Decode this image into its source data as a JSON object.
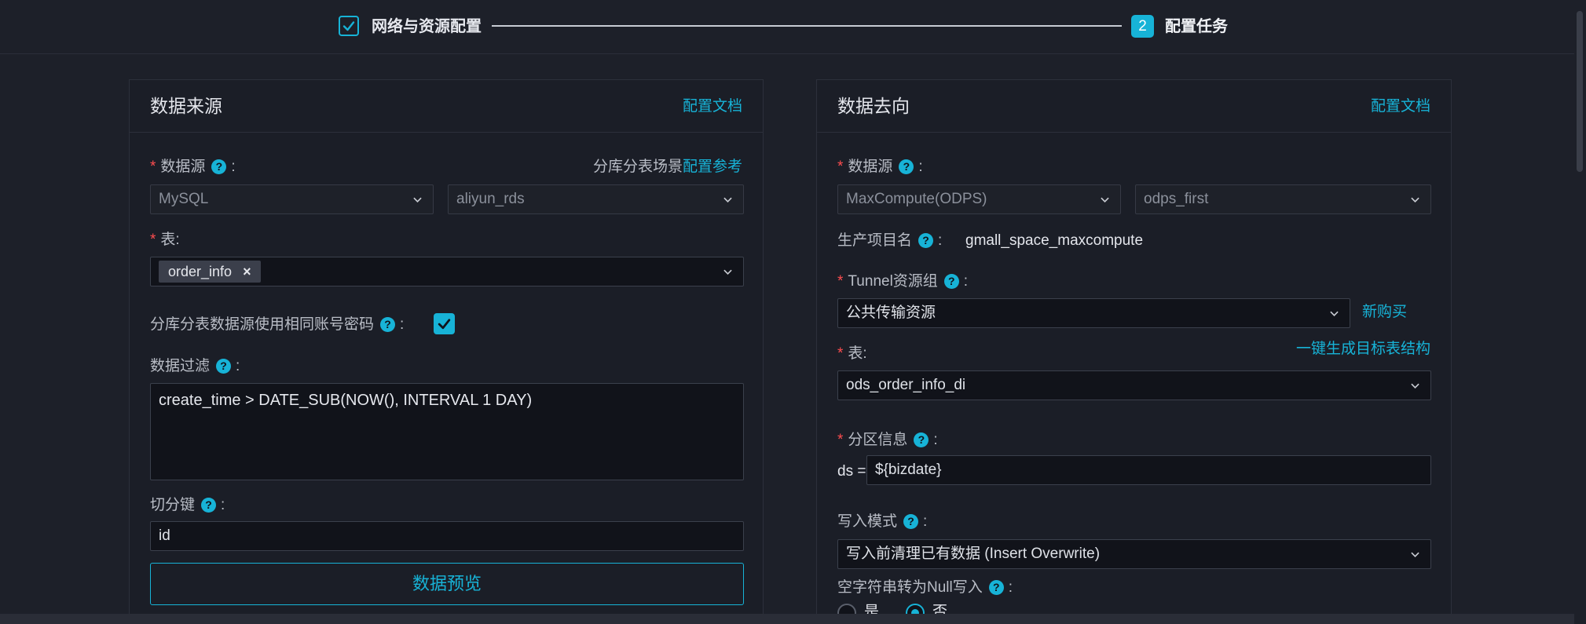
{
  "stepper": {
    "step1_label": "网络与资源配置",
    "step2_number": "2",
    "step2_label": "配置任务"
  },
  "source": {
    "title": "数据来源",
    "doc_link": "配置文档",
    "datasource_label": "数据源",
    "sharding_hint": "分库分表场景",
    "sharding_link": "配置参考",
    "datasource_type": "MySQL",
    "datasource_name": "aliyun_rds",
    "table_label": "表:",
    "table_tag": "order_info",
    "same_account_label": "分库分表数据源使用相同账号密码",
    "filter_label": "数据过滤",
    "filter_value": "create_time > DATE_SUB(NOW(), INTERVAL 1 DAY)",
    "split_key_label": "切分键",
    "split_key_value": "id",
    "preview_button": "数据预览"
  },
  "dest": {
    "title": "数据去向",
    "doc_link": "配置文档",
    "datasource_label": "数据源",
    "datasource_type": "MaxCompute(ODPS)",
    "datasource_name": "odps_first",
    "project_label": "生产项目名",
    "project_value": "gmall_space_maxcompute",
    "tunnel_label": "Tunnel资源组",
    "tunnel_value": "公共传输资源",
    "buy_link": "新购买",
    "table_label": "表:",
    "gen_link": "一键生成目标表结构",
    "table_value": "ods_order_info_di",
    "partition_label": "分区信息",
    "partition_prefix": "ds =",
    "partition_value": "${bizdate}",
    "write_mode_label": "写入模式",
    "write_mode_value": "写入前清理已有数据 (Insert Overwrite)",
    "null_label": "空字符串转为Null写入",
    "radio_yes": "是",
    "radio_no": "否"
  },
  "colors": {
    "accent": "#17b3d7",
    "required": "#ff4d4f",
    "background": "#1d2029"
  }
}
